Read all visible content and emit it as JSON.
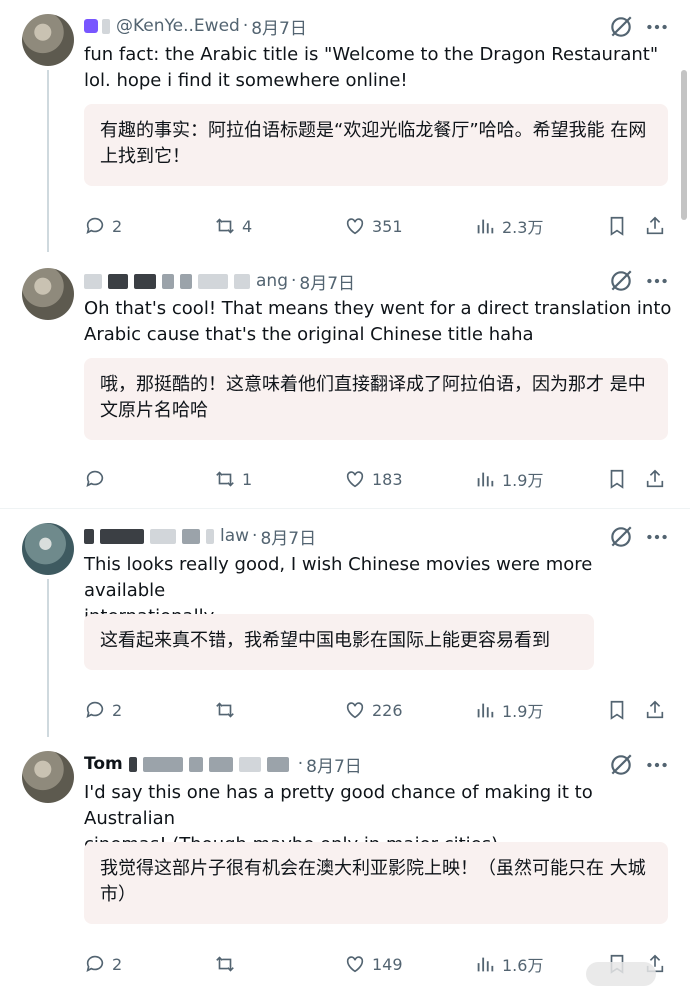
{
  "posts": [
    {
      "handle": "@KenYe..Ewed",
      "date": "8月7日",
      "text": "fun fact: the Arabic title is \"Welcome to the Dragon Restaurant\"\nlol. hope i find it somewhere online!",
      "translation": "有趣的事实：阿拉伯语标题是“欢迎光临龙餐厅”哈哈。希望我能\n在网上找到它！",
      "replies": "2",
      "reposts": "4",
      "likes": "351",
      "views": "2.3万"
    },
    {
      "handle": "ang",
      "date": "8月7日",
      "text": "Oh that's cool! That means they went for a direct translation into\nArabic cause that's the original Chinese title haha",
      "translation": "哦，那挺酷的！这意味着他们直接翻译成了阿拉伯语，因为那才\n是中文原片名哈哈",
      "replies": "",
      "reposts": "1",
      "likes": "183",
      "views": "1.9万"
    },
    {
      "handle": "law",
      "date": "8月7日",
      "text": "This looks really good, I wish Chinese movies were more available\ninternationally",
      "translation": "这看起来真不错，我希望中国电影在国际上能更容易看到",
      "replies": "2",
      "reposts": "",
      "likes": "226",
      "views": "1.9万"
    },
    {
      "handle": "Tom",
      "date": "8月7日",
      "text": "I'd say this one has a pretty good chance of making it to Australian\ncinemas! (Though maybe only in major cities)",
      "translation": "我觉得这部片子很有机会在澳大利亚影院上映！（虽然可能只在\n大城市）",
      "replies": "2",
      "reposts": "",
      "likes": "149",
      "views": "1.6万"
    }
  ],
  "icons": {
    "reply": "reply-icon",
    "repost": "repost-icon",
    "like": "like-icon",
    "views": "views-icon",
    "bookmark": "bookmark-icon",
    "share": "share-icon",
    "grok": "grok-icon",
    "more": "more-icon"
  },
  "colors": {
    "text": "#0f1419",
    "muted": "#536471",
    "translation_bg": "#f9f1f0",
    "divider": "#eff3f4"
  }
}
